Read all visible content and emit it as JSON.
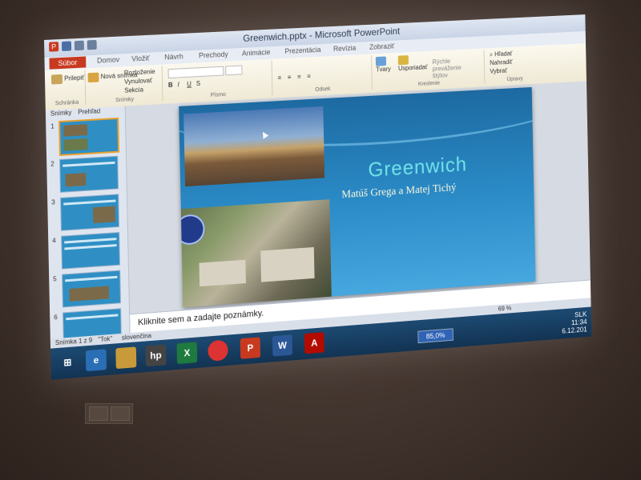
{
  "window": {
    "title": "Greenwich.pptx - Microsoft PowerPoint"
  },
  "ribbon_tabs": [
    "Súbor",
    "Domov",
    "Vložiť",
    "Návrh",
    "Prechody",
    "Animácie",
    "Prezentácia",
    "Revízia",
    "Zobraziť"
  ],
  "ribbon": {
    "paste": "Prilepiť",
    "new_slide": "Nová snímka",
    "layout": "Rozloženie",
    "reset": "Vynulovať",
    "section": "Sekcia",
    "group_clipboard": "Schránka",
    "group_slides": "Snímky",
    "group_font": "Písmo",
    "group_paragraph": "Odsek",
    "shapes": "Tvary",
    "arrange": "Usporiadať",
    "quick_styles": "Rýchle preváženie štýlov",
    "group_drawing": "Kreslenie",
    "find": "Hľadať",
    "replace": "Nahradiť",
    "select": "Vybrať",
    "group_editing": "Úpravy"
  },
  "panel": {
    "tab_slides": "Snímky",
    "tab_outline": "Prehľad",
    "slide_numbers": [
      "1",
      "2",
      "3",
      "4",
      "5",
      "6"
    ]
  },
  "slide": {
    "title": "Greenwich",
    "subtitle": "Matúš Grega a Matej Tichý"
  },
  "notes": {
    "placeholder": "Kliknite sem a zadajte poznámky."
  },
  "status": {
    "slide_info": "Snímka 1 z 9",
    "theme": "\"Tok\"",
    "language": "slovenčina",
    "zoom": "69 %"
  },
  "taskbar": {
    "battery": "85,0%",
    "language": "SLK",
    "time": "11:34",
    "date": "6.12.201"
  },
  "colors": {
    "slide_title": "#6fe3e8",
    "file_tab": "#c83a1f",
    "taskbar": "#1d4a72"
  }
}
